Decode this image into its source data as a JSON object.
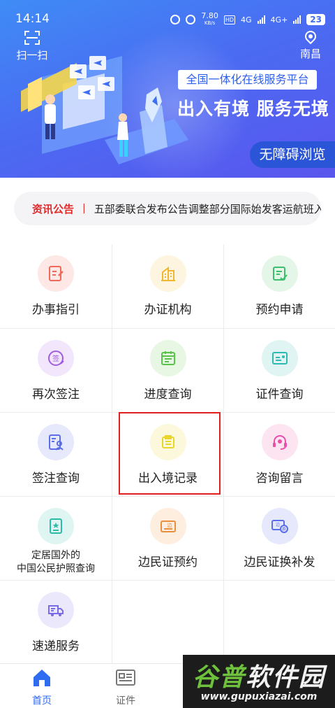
{
  "status_bar": {
    "time": "14:14",
    "speed": "7.80",
    "speed_unit": "KB/s",
    "net1": "4G",
    "net2": "4G+",
    "battery": "23"
  },
  "header": {
    "scan_label": "扫一扫",
    "location": "南昌",
    "platform_tag": "全国一体化在线服务平台",
    "slogan": "出入有境  服务无境",
    "accessibility_button": "无障碍浏览"
  },
  "notice": {
    "tag": "资讯公告",
    "separator": "|",
    "text": "五部委联合发布公告调整部分国际始发客运航班入境点"
  },
  "services": [
    {
      "label": "办事指引",
      "icon": "edit-document-icon",
      "color": "#f06a5c",
      "bg": "#fde8e6"
    },
    {
      "label": "办证机构",
      "icon": "building-icon",
      "color": "#f2b630",
      "bg": "#fdf5df"
    },
    {
      "label": "预约申请",
      "icon": "checklist-icon",
      "color": "#3cbf6a",
      "bg": "#e3f6e8"
    },
    {
      "label": "再次签注",
      "icon": "sign-stamp-icon",
      "color": "#a05ce0",
      "bg": "#f1e6fb"
    },
    {
      "label": "进度查询",
      "icon": "calendar-icon",
      "color": "#58c44a",
      "bg": "#e8f7e4"
    },
    {
      "label": "证件查询",
      "icon": "id-card-icon",
      "color": "#2dbab0",
      "bg": "#e0f5f3"
    },
    {
      "label": "签注查询",
      "icon": "person-document-icon",
      "color": "#5b6de8",
      "bg": "#e6e9fb"
    },
    {
      "label": "出入境记录",
      "icon": "record-folder-icon",
      "color": "#e9d62c",
      "bg": "#fbf8dc"
    },
    {
      "label": "咨询留言",
      "icon": "headset-icon",
      "color": "#e84fa8",
      "bg": "#fce4f1"
    },
    {
      "label_line1": "定居国外的",
      "label_line2": "中国公民护照查询",
      "icon": "passport-icon",
      "color": "#2dbcaa",
      "bg": "#dff5f1"
    },
    {
      "label": "边民证预约",
      "icon": "border-pass-icon",
      "color": "#ea8f3e",
      "bg": "#fdeedf"
    },
    {
      "label": "边民证换补发",
      "icon": "border-pass-exchange-icon",
      "color": "#5b6de8",
      "bg": "#e6e9fb"
    },
    {
      "label": "速递服务",
      "icon": "delivery-truck-icon",
      "color": "#7a6ce6",
      "bg": "#ebe8fb"
    }
  ],
  "bottom_nav": {
    "home": "首页",
    "documents": "证件"
  },
  "watermark": {
    "title_part1": "谷普",
    "title_part2": "软件园",
    "url": "www.gupuxiazai.com"
  },
  "colors": {
    "accent": "#2f6cf0",
    "notice_red": "#e02b2b",
    "highlight_red": "#e02020"
  }
}
